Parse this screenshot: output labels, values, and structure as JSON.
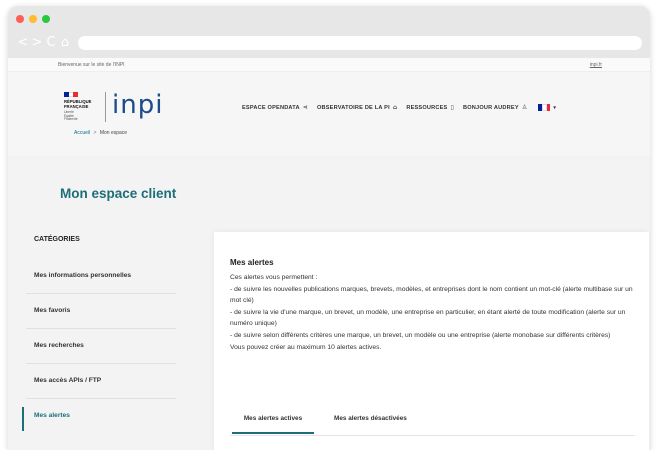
{
  "browser": {
    "nav_icons": [
      "<",
      ">",
      "C",
      "⌂"
    ]
  },
  "topbar": {
    "welcome": "Bienvenue sur le site de l'INPI",
    "link": "inpi.fr"
  },
  "header": {
    "republique": [
      "RÉPUBLIQUE",
      "FRANÇAISE"
    ],
    "motto": [
      "Liberté",
      "Égalité",
      "Fraternité"
    ],
    "logo_text": "inpi",
    "breadcrumb": {
      "home": "Accueil",
      "separator": ">",
      "current": "Mon espace"
    },
    "nav": [
      {
        "label": "ESPACE OPENDATA",
        "icon": "share-icon",
        "glyph": "⋖"
      },
      {
        "label": "OBSERVATOIRE DE LA PI",
        "icon": "building-icon",
        "glyph": "⌂"
      },
      {
        "label": "RESSOURCES",
        "icon": "document-icon",
        "glyph": "▯"
      },
      {
        "label": "BONJOUR AUDREY",
        "icon": "user-icon",
        "glyph": "♙"
      }
    ],
    "language_chevron": "▾"
  },
  "colors": {
    "accent": "#1c6f78",
    "flag_blue": "#002395",
    "flag_white": "#ffffff",
    "flag_red": "#ed2939"
  },
  "page": {
    "title": "Mon espace client",
    "sidebar": {
      "title": "CATÉGORIES",
      "items": [
        {
          "label": "Mes informations personnelles"
        },
        {
          "label": "Mes favoris"
        },
        {
          "label": "Mes recherches"
        },
        {
          "label": "Mes accès APIs / FTP"
        },
        {
          "label": "Mes alertes"
        }
      ]
    },
    "alerts": {
      "title": "Mes alertes",
      "intro": "Ces alertes vous permettent :",
      "line1": "- de suivre les nouvelles publications marques, brevets, modèles, et entreprises dont le nom contient un mot-clé (alerte multibase sur un mot clé)",
      "line2": "- de suivre la vie d'une marque, un brevet, un modèle, une entreprise en particulier, en étant alerté de toute modification (alerte sur un numéro unique)",
      "line3": "- de suivre selon différents critères une marque, un brevet, un modèle ou une entreprise (alerte monobase sur différents critères)",
      "line4": "Vous pouvez créer au maximum 10 alertes actives.",
      "tabs": [
        "Mes alertes actives",
        "Mes alertes désactivées"
      ]
    }
  }
}
